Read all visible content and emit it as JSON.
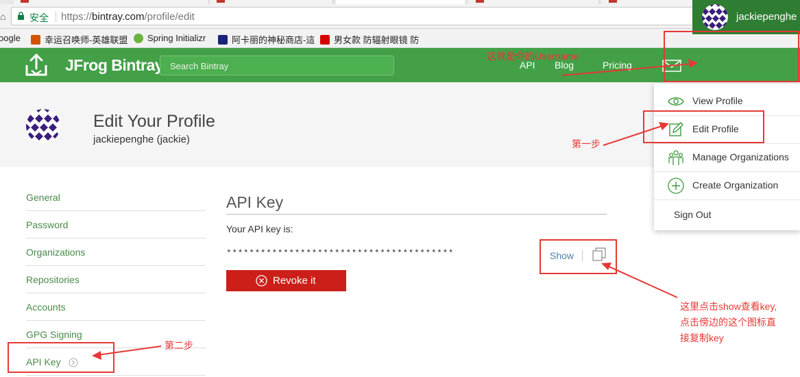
{
  "browser": {
    "secure_label": "安全",
    "url_scheme": "https://",
    "url_host": "bintray.com",
    "url_path": "/profile/edit",
    "bookmarks": [
      {
        "label": "oogle",
        "color": "#4285f4"
      },
      {
        "label": "幸运召唤师-英雄联盟",
        "color": "#d35400"
      },
      {
        "label": "Spring Initializr",
        "color": "#6db33f"
      },
      {
        "label": "阿卡丽的神秘商店-這",
        "color": "#1a237e"
      },
      {
        "label": "男女款 防辐射眼镜 防",
        "color": "#d50000"
      }
    ]
  },
  "site": {
    "brand": "JFrog Bintray",
    "search_placeholder": "Search Bintray",
    "nav": [
      "API",
      "Blog",
      "Pricing"
    ],
    "username": "jackiepenghe",
    "accent": "#43a047",
    "accent_dark": "#2e7d32"
  },
  "profile": {
    "title": "Edit Your Profile",
    "subtitle": "jackiepenghe (jackie)"
  },
  "sidebar": {
    "items": [
      {
        "label": "General"
      },
      {
        "label": "Password"
      },
      {
        "label": "Organizations"
      },
      {
        "label": "Repositories"
      },
      {
        "label": "Accounts"
      },
      {
        "label": "GPG Signing"
      },
      {
        "label": "API Key"
      }
    ]
  },
  "apikey": {
    "section_title": "API Key",
    "label": "Your API key is:",
    "masked": "****************************************",
    "show_label": "Show",
    "revoke_label": "Revoke it",
    "revoke_color": "#cc1f1a"
  },
  "dropdown": {
    "items": [
      {
        "label": "View Profile",
        "icon": "eye-icon"
      },
      {
        "label": "Edit Profile",
        "icon": "edit-icon"
      },
      {
        "label": "Manage Organizations",
        "icon": "people-icon"
      },
      {
        "label": "Create Organization",
        "icon": "plus-circle-icon"
      },
      {
        "label": "Sign Out",
        "icon": ""
      }
    ]
  },
  "annotations": {
    "username_note": "这就是你的Username",
    "step1": "第一步",
    "step2": "第二步",
    "show_note": [
      "这里点击show查看key,",
      "点击傍边的这个图标直",
      "接复制key"
    ],
    "color": "#e53935"
  }
}
